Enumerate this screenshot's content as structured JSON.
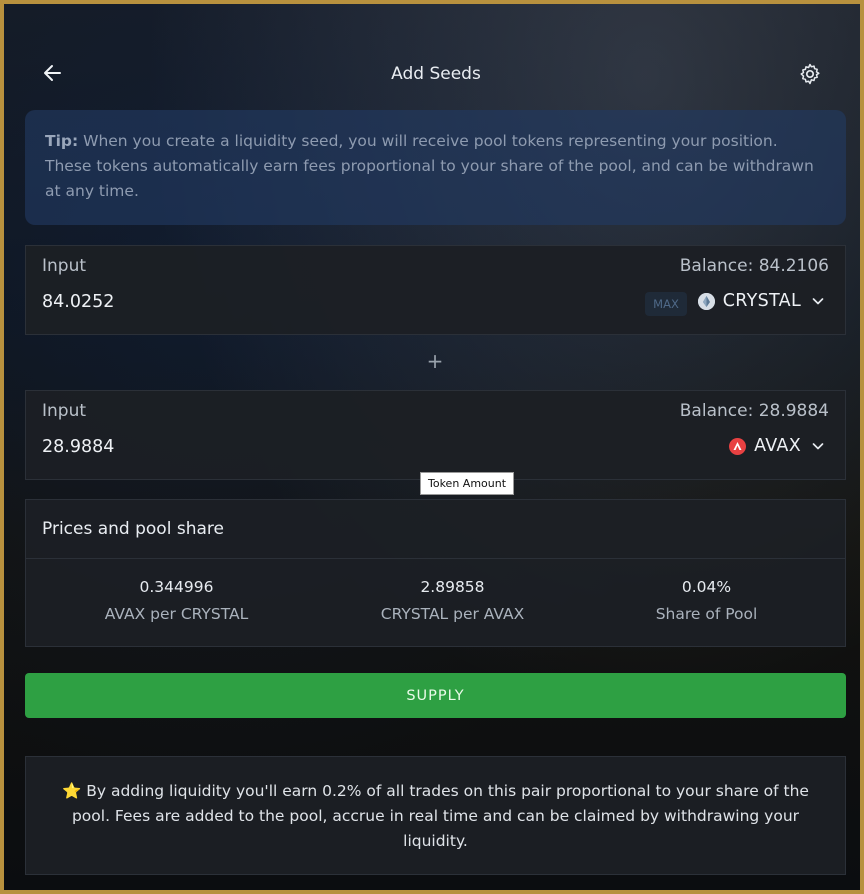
{
  "header": {
    "title": "Add Seeds"
  },
  "tip": {
    "label": "Tip:",
    "text": " When you create a liquidity seed, you will receive pool tokens representing your position. These tokens automatically earn fees proportional to your share of the pool, and can be withdrawn at any time."
  },
  "input1": {
    "label": "Input",
    "balance": "Balance: 84.2106",
    "amount": "84.0252",
    "max_label": "MAX",
    "token": "CRYSTAL"
  },
  "separator": {
    "symbol": "+"
  },
  "input2": {
    "label": "Input",
    "balance": "Balance: 28.9884",
    "amount": "28.9884",
    "token": "AVAX"
  },
  "tooltip": {
    "text": "Token Amount"
  },
  "prices": {
    "title": "Prices and pool share",
    "stats": [
      {
        "value": "0.344996",
        "label": "AVAX per CRYSTAL"
      },
      {
        "value": "2.89858",
        "label": "CRYSTAL per AVAX"
      },
      {
        "value": "0.04%",
        "label": "Share of Pool"
      }
    ]
  },
  "supply": {
    "label": "SUPPLY"
  },
  "info": {
    "star": "⭐",
    "text": " By adding liquidity you'll earn 0.2% of all trades on this pair proportional to your share of the pool. Fees are added to the pool, accrue in real time and can be claimed by withdrawing your liquidity."
  },
  "colors": {
    "accent_green": "#2ea043",
    "frame_gold": "#b8913e",
    "avax_red": "#e84142"
  },
  "icons": {
    "back": "arrow-left-icon",
    "settings": "gear-icon",
    "chevron": "chevron-down-icon",
    "crystal": "crystal-token-icon",
    "avax": "avax-token-icon"
  }
}
